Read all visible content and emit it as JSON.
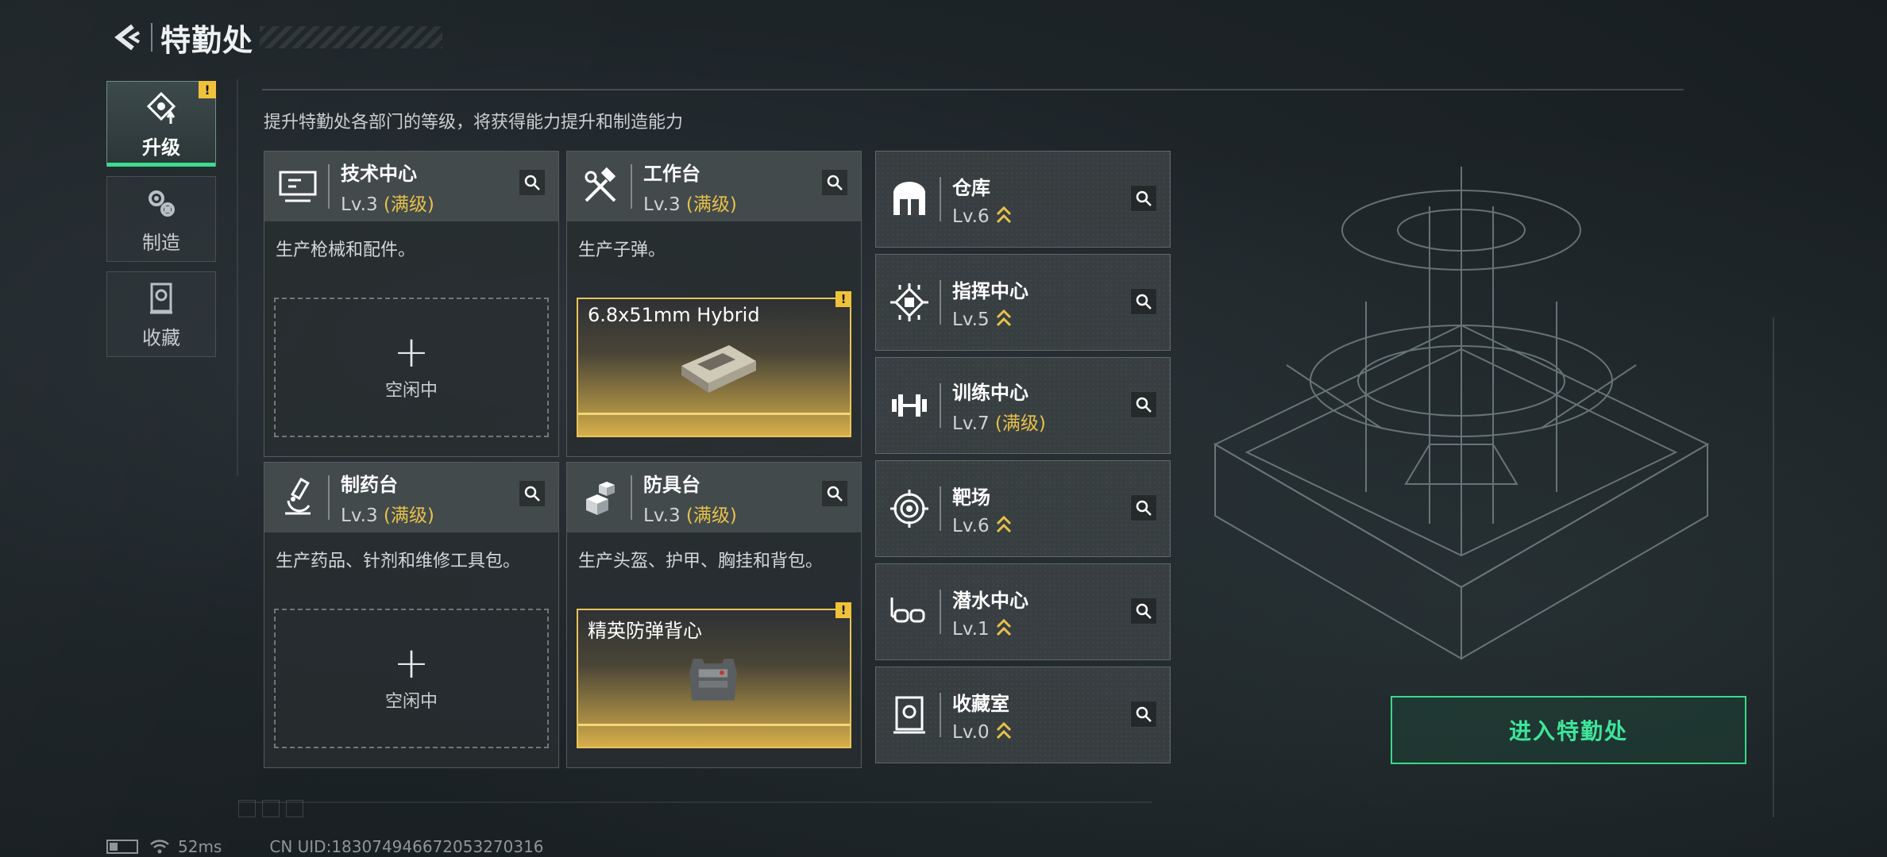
{
  "header": {
    "title": "特勤处"
  },
  "nav": {
    "items": [
      {
        "label": "升级",
        "icon": "upgrade-icon",
        "active": true,
        "alert": "!"
      },
      {
        "label": "制造",
        "icon": "gears-icon",
        "active": false
      },
      {
        "label": "收藏",
        "icon": "collection-icon",
        "active": false
      }
    ]
  },
  "subtitle": "提升特勤处各部门的等级，将获得能力提升和制造能力",
  "production": [
    {
      "name": "技术中心",
      "level": "Lv.3",
      "max": "(满级)",
      "desc": "生产枪械和配件。",
      "status": "空闲中",
      "icon": "monitor-icon"
    },
    {
      "name": "工作台",
      "level": "Lv.3",
      "max": "(满级)",
      "desc": "生产子弹。",
      "item": "6.8x51mm Hybrid",
      "alert": "!",
      "icon": "hammer-wrench-icon"
    },
    {
      "name": "制药台",
      "level": "Lv.3",
      "max": "(满级)",
      "desc": "生产药品、针剂和维修工具包。",
      "status": "空闲中",
      "icon": "microscope-icon"
    },
    {
      "name": "防具台",
      "level": "Lv.3",
      "max": "(满级)",
      "desc": "生产头盔、护甲、胸挂和背包。",
      "item": "精英防弹背心",
      "alert": "!",
      "icon": "boxes-icon"
    }
  ],
  "departments": [
    {
      "name": "仓库",
      "level": "Lv.6",
      "max": "",
      "icon": "warehouse-icon"
    },
    {
      "name": "指挥中心",
      "level": "Lv.5",
      "max": "",
      "icon": "chip-icon"
    },
    {
      "name": "训练中心",
      "level": "Lv.7",
      "max": "(满级)",
      "icon": "dumbbell-icon"
    },
    {
      "name": "靶场",
      "level": "Lv.6",
      "max": "",
      "icon": "target-icon"
    },
    {
      "name": "潜水中心",
      "level": "Lv.1",
      "max": "",
      "icon": "diving-mask-icon"
    },
    {
      "name": "收藏室",
      "level": "Lv.0",
      "max": "",
      "icon": "trophy-case-icon"
    }
  ],
  "enter_button": "进入特勤处",
  "footer": {
    "ping": "52ms",
    "uid": "CN UID:1830749466720532703​16"
  },
  "colors": {
    "accent_green": "#3ee59a",
    "gold": "#e8c14a",
    "alert_yellow": "#f0c23c"
  }
}
